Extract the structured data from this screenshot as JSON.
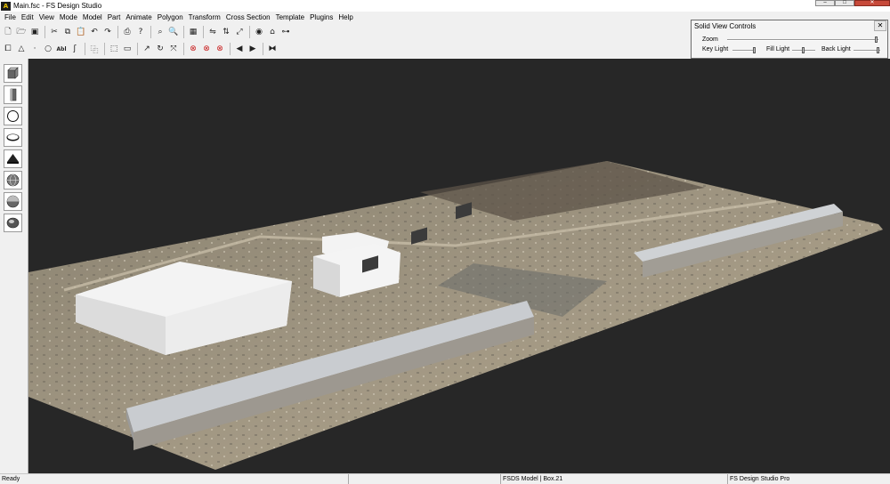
{
  "window": {
    "title": "Main.fsc - FS Design Studio",
    "app_icon_text": "A",
    "minimize": "–",
    "maximize": "□",
    "close": "✕"
  },
  "menu": [
    "File",
    "Edit",
    "View",
    "Mode",
    "Model",
    "Part",
    "Animate",
    "Polygon",
    "Transform",
    "Cross Section",
    "Template",
    "Plugins",
    "Help"
  ],
  "toolbar1": {
    "icons": [
      "new-file-icon",
      "open-folder-icon",
      "save-icon",
      "cut-icon",
      "copy-icon",
      "paste-icon",
      "undo-icon",
      "redo-icon",
      "print-icon",
      "help-icon",
      "zoom-in-icon",
      "zoom-out-icon",
      "grid-icon",
      "mirror-x-icon",
      "mirror-y-icon",
      "mirror-z-icon",
      "eye-icon",
      "house-icon",
      "link-icon"
    ]
  },
  "toolbar2": {
    "icons": [
      "box-select-icon",
      "triangle-icon",
      "dot-icon",
      "circle-icon",
      "text-icon",
      "spiral-icon",
      "copy-part-icon",
      "select-rect-icon",
      "ruler-icon",
      "rotate-icon",
      "refresh-icon",
      "fit-icon",
      "no-entry-icon",
      "no-entry-icon",
      "no-entry-icon",
      "prev-icon",
      "next-icon",
      "binoculars-icon"
    ],
    "text_label": "Abl"
  },
  "solid_view_controls": {
    "title": "Solid View Controls",
    "close": "✕",
    "zoom_label": "Zoom",
    "key_light_label": "Key Light",
    "fill_light_label": "Fill Light",
    "back_light_label": "Back Light"
  },
  "left_toolbar": {
    "icons": [
      "cube-icon",
      "column-icon",
      "sphere-icon",
      "disc-icon",
      "cone-icon",
      "globe-icon",
      "hemisphere-icon",
      "ellipsoid-icon"
    ]
  },
  "status": {
    "left": "Ready",
    "middle": "FSDS Model | Box.21",
    "right": "FS Design Studio Pro"
  }
}
